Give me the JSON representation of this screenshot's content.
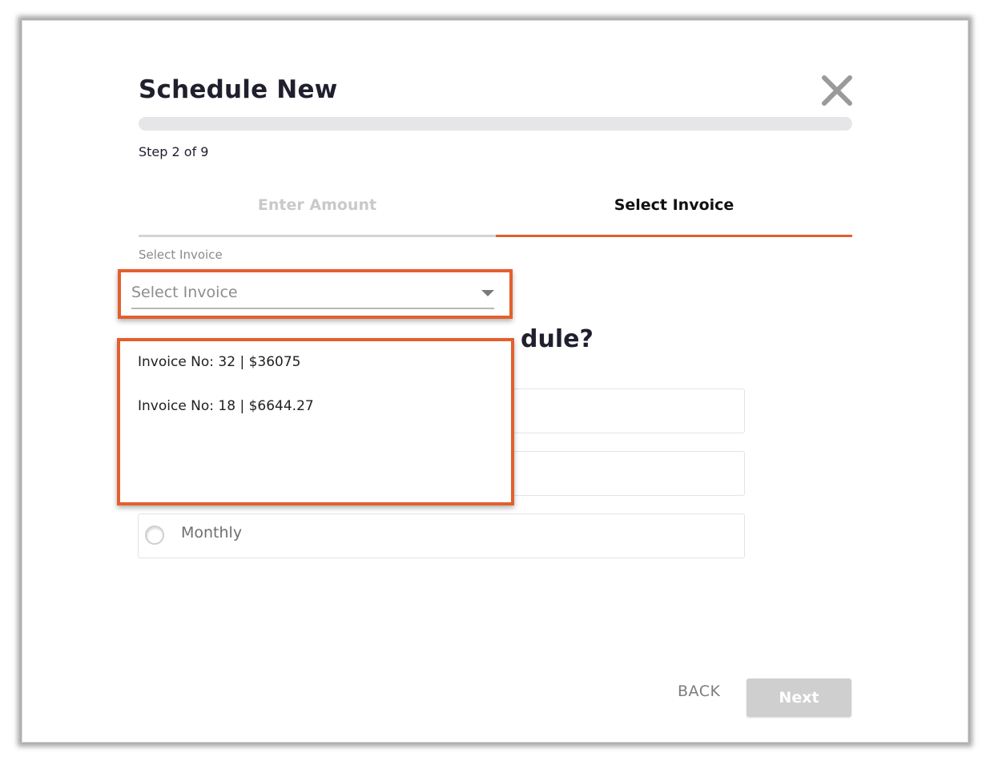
{
  "modal": {
    "title": "Schedule New",
    "step_text": "Step 2 of 9",
    "progress": 0.0
  },
  "tabs": [
    {
      "label": "Enter Amount",
      "active": false
    },
    {
      "label": "Select Invoice",
      "active": true
    }
  ],
  "invoice_select": {
    "label": "Select Invoice",
    "placeholder": "Select Invoice",
    "options": [
      "Invoice No: 32 | $36075",
      "Invoice No: 18 | $6644.27"
    ]
  },
  "schedule": {
    "question_visible": "dule?",
    "frequency_options": [
      "",
      "",
      "Monthly"
    ]
  },
  "footer": {
    "back_label": "BACK",
    "next_label": "Next"
  },
  "colors": {
    "accent": "#e35f2d",
    "title": "#1f1f2e",
    "disabled_button": "#cfcfcf"
  },
  "icons": {
    "close": "close-icon",
    "caret": "chevron-down-icon"
  }
}
